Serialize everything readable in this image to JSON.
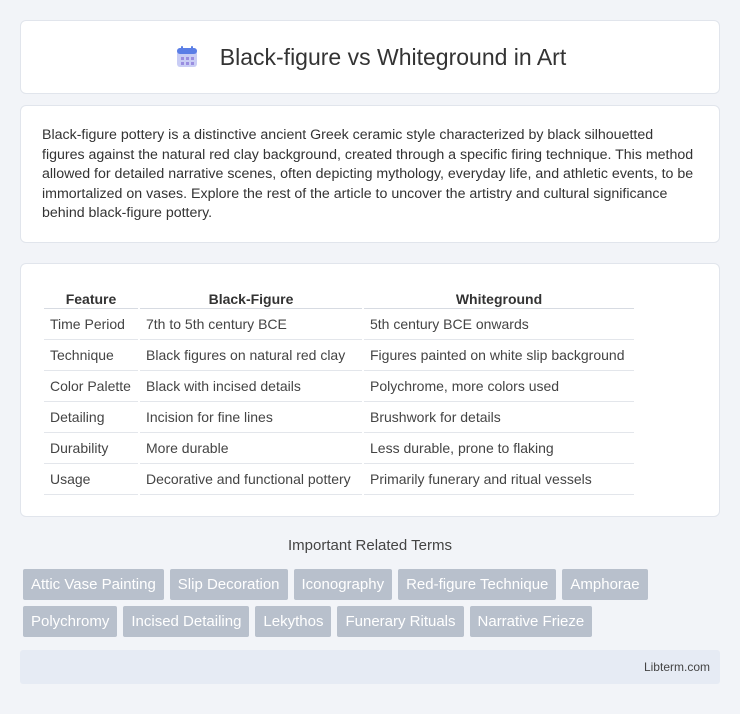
{
  "header": {
    "title": "Black-figure vs Whiteground in Art",
    "icon": "calendar-icon"
  },
  "intro": {
    "text": "Black-figure pottery is a distinctive ancient Greek ceramic style characterized by black silhouetted figures against the natural red clay background, created through a specific firing technique. This method allowed for detailed narrative scenes, often depicting mythology, everyday life, and athletic events, to be immortalized on vases. Explore the rest of the article to uncover the artistry and cultural significance behind black-figure pottery."
  },
  "table": {
    "headers": [
      "Feature",
      "Black-Figure",
      "Whiteground"
    ],
    "rows": [
      [
        "Time Period",
        "7th to 5th century BCE",
        "5th century BCE onwards"
      ],
      [
        "Technique",
        "Black figures on natural red clay",
        "Figures painted on white slip background"
      ],
      [
        "Color Palette",
        "Black with incised details",
        "Polychrome, more colors used"
      ],
      [
        "Detailing",
        "Incision for fine lines",
        "Brushwork for details"
      ],
      [
        "Durability",
        "More durable",
        "Less durable, prone to flaking"
      ],
      [
        "Usage",
        "Decorative and functional pottery",
        "Primarily funerary and ritual vessels"
      ]
    ]
  },
  "related": {
    "title": "Important Related Terms",
    "tags": [
      "Attic Vase Painting",
      "Slip Decoration",
      "Iconography",
      "Red-figure Technique",
      "Amphorae",
      "Polychromy",
      "Incised Detailing",
      "Lekythos",
      "Funerary Rituals",
      "Narrative Frieze"
    ]
  },
  "footer": {
    "text": "Libterm.com"
  },
  "colors": {
    "tag_bg": "#b8c0cc",
    "footer_bg": "#e6ebf4",
    "page_bg": "#f2f4f8"
  }
}
